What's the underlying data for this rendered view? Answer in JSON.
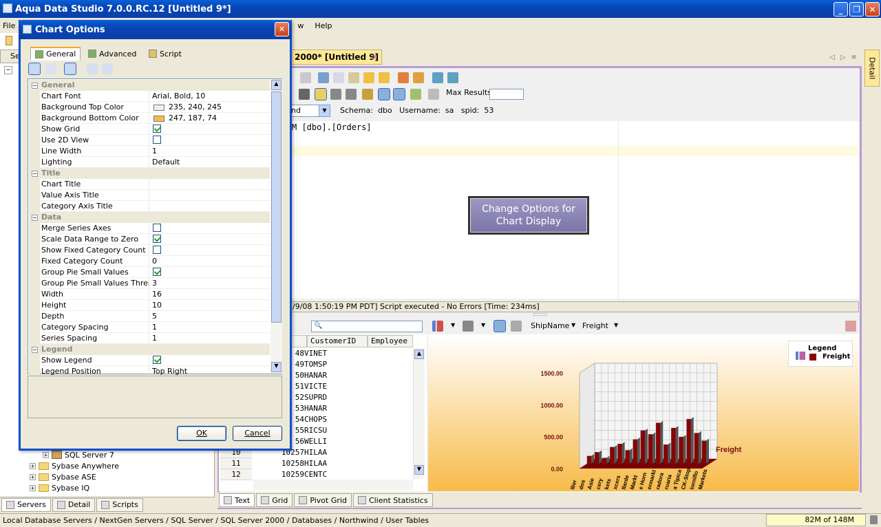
{
  "app": {
    "title": "Aqua Data Studio 7.0.0.RC.12 [Untitled 9*]"
  },
  "menu": {
    "file": "File",
    "view_tail": "w",
    "help": "Help"
  },
  "tree": {
    "sql_server_7": "SQL Server 7",
    "sybase_anywhere": "Sybase Anywhere",
    "sybase_ase": "Sybase ASE",
    "sybase_iq": "Sybase IQ"
  },
  "left_tabs": {
    "servers": "Servers",
    "detail": "Detail",
    "scripts": "Scripts"
  },
  "left_top_label": "Se",
  "editor": {
    "tab_title": "2000* [Untitled 9]",
    "max_results_label": "Max Results:",
    "db_select_value": "nd",
    "schema_label": "Schema:",
    "schema_value": "dbo",
    "username_label": "Username:",
    "username_value": "sa",
    "spid_label": "spid:",
    "spid_value": "53",
    "sql_text": "M [dbo].[Orders]",
    "callout": "Change Options for Chart Display",
    "status": "/9/08 1:50:19 PM PDT] Script executed - No Errors [Time: 234ms]"
  },
  "grid": {
    "headers": [
      "CustomerID",
      "Employee"
    ],
    "rows": [
      {
        "num": "",
        "id": "48",
        "cust": "VINET"
      },
      {
        "num": "",
        "id": "49",
        "cust": "TOMSP"
      },
      {
        "num": "",
        "id": "50",
        "cust": "HANAR"
      },
      {
        "num": "",
        "id": "51",
        "cust": "VICTE"
      },
      {
        "num": "",
        "id": "52",
        "cust": "SUPRD"
      },
      {
        "num": "",
        "id": "53",
        "cust": "HANAR"
      },
      {
        "num": "",
        "id": "54",
        "cust": "CHOPS"
      },
      {
        "num": "",
        "id": "55",
        "cust": "RICSU"
      },
      {
        "num": "",
        "id": "56",
        "cust": "WELLI"
      },
      {
        "num": "10",
        "id": "10257",
        "cust": "HILAA"
      },
      {
        "num": "11",
        "id": "10258",
        "cust": "HILAA"
      },
      {
        "num": "12",
        "id": "10259",
        "cust": "CENTC"
      }
    ]
  },
  "chart_toolbar": {
    "category": "ShipName",
    "value": "Freight"
  },
  "chart_data": {
    "type": "bar",
    "title": "",
    "legend": {
      "title": "Legend",
      "series": "Freight",
      "position": "top-right"
    },
    "series_label": "Freight",
    "y_ticks": [
      "1500.00",
      "1000.00",
      "500.00",
      "0.00"
    ],
    "ylim": [
      0,
      1500
    ],
    "categories": [
      "llier",
      "dos",
      "Asie",
      "cery",
      "kets",
      "xcers",
      "llarde",
      "Markt",
      "e Horn",
      "ermarkt",
      "radora",
      "ruaria",
      "a Tipica",
      "CK-Stop",
      "torniflo",
      "Markets"
    ],
    "values": [
      120,
      180,
      90,
      260,
      310,
      210,
      380,
      520,
      460,
      640,
      300,
      560,
      420,
      700,
      480,
      360
    ],
    "color": "#8b0000"
  },
  "bottom_tabs": {
    "text": "Text",
    "grid": "Grid",
    "pivot": "Pivot Grid",
    "client_stats": "Client Statistics"
  },
  "statusbar": {
    "path": "Local Database Servers / NextGen Servers / SQL Server / SQL Server 2000 / Databases / Northwind / User Tables",
    "memory": "82M of 148M"
  },
  "right_panel": {
    "detail": "Detail"
  },
  "dialog": {
    "title": "Chart Options",
    "tabs": [
      "General",
      "Advanced",
      "Script"
    ],
    "properties": [
      {
        "cat": "General"
      },
      {
        "label": "Chart Font",
        "value": "Arial, Bold, 10"
      },
      {
        "label": "Background Top Color",
        "value": "235, 240, 245",
        "swatch": "#ebf0f5"
      },
      {
        "label": "Background Bottom Color",
        "value": "247, 187, 74",
        "swatch": "#f7bb4a"
      },
      {
        "label": "Show Grid",
        "check": true
      },
      {
        "label": "Use 2D View",
        "check": false
      },
      {
        "label": "Line Width",
        "value": "1"
      },
      {
        "label": "Lighting",
        "value": "Default"
      },
      {
        "cat": "Title"
      },
      {
        "label": "Chart Title",
        "value": ""
      },
      {
        "label": "Value Axis Title",
        "value": ""
      },
      {
        "label": "Category Axis Title",
        "value": ""
      },
      {
        "cat": "Data"
      },
      {
        "label": "Merge Series Axes",
        "check": false
      },
      {
        "label": "Scale Data Range to Zero",
        "check": true
      },
      {
        "label": "Show Fixed Category Count",
        "check": false
      },
      {
        "label": "Fixed Category Count",
        "value": "0"
      },
      {
        "label": "Group Pie Small Values",
        "check": true
      },
      {
        "label": "Group Pie Small Values Thresh...",
        "value": "3"
      },
      {
        "label": "Width",
        "value": "16"
      },
      {
        "label": "Height",
        "value": "10"
      },
      {
        "label": "Depth",
        "value": "5"
      },
      {
        "label": "Category Spacing",
        "value": "1"
      },
      {
        "label": "Series Spacing",
        "value": "1"
      },
      {
        "cat": "Legend"
      },
      {
        "label": "Show Legend",
        "check": true
      },
      {
        "label": "Legend Position",
        "value": "Top Right"
      }
    ],
    "ok": "OK",
    "cancel": "Cancel"
  }
}
